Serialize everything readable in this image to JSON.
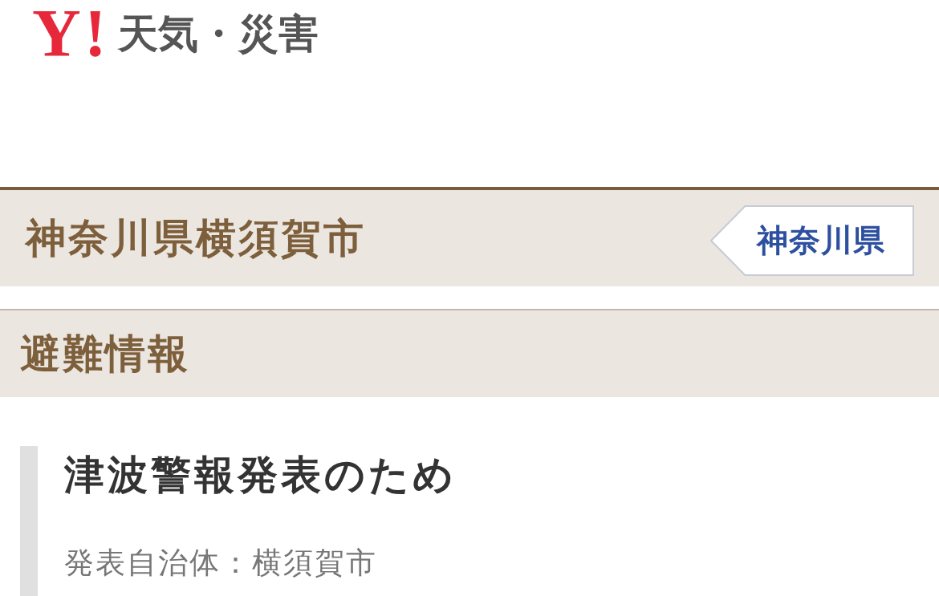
{
  "header": {
    "logo_mark": "Y!",
    "site_title": "天気・災害"
  },
  "location": {
    "title": "神奈川県横須賀市",
    "back_link": "神奈川県"
  },
  "section": {
    "title": "避難情報"
  },
  "notices": [
    {
      "title": "津波警報発表のため",
      "issuer": "発表自治体：横須賀市"
    }
  ]
}
